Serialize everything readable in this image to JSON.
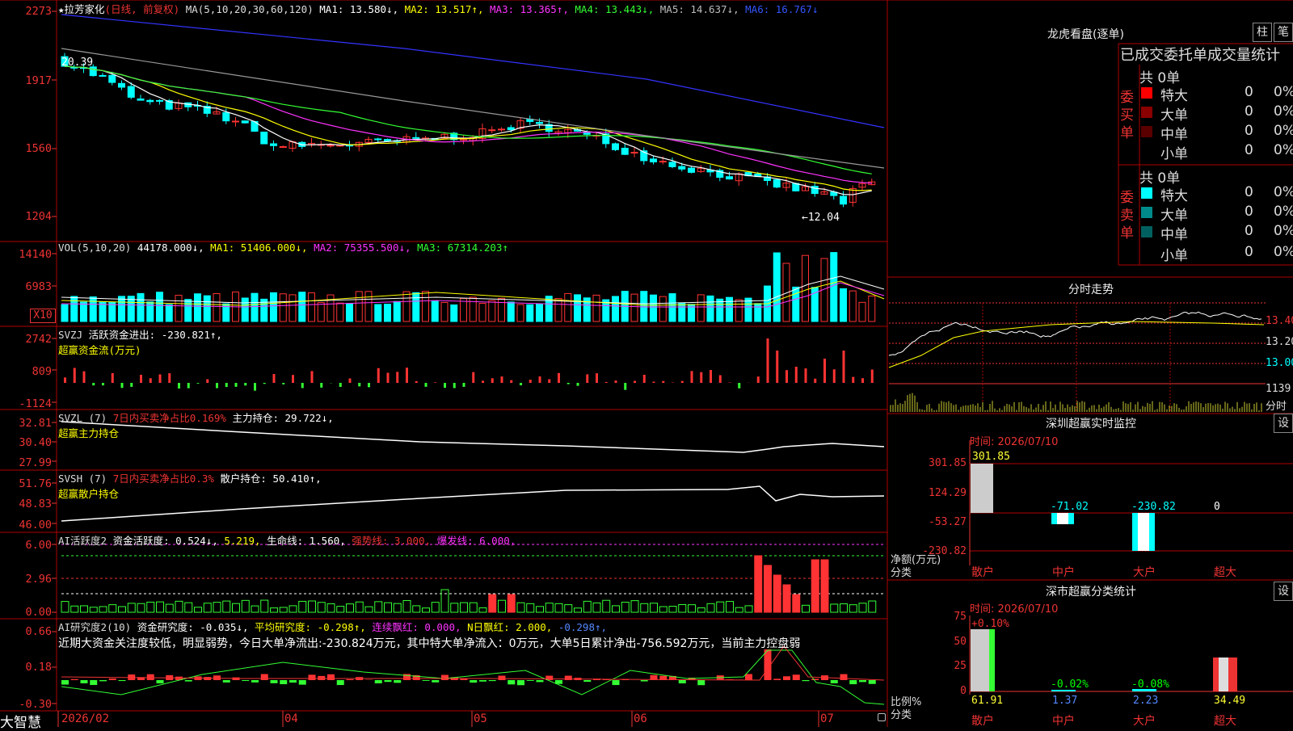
{
  "colors": {
    "up": "#ff3333",
    "down": "#00ffff",
    "ma1": "#ffffff",
    "ma2": "#ffff00",
    "ma3": "#ff33ff",
    "ma4": "#33ff33",
    "ma5": "#999999",
    "ma6": "#3333ff",
    "grid": "#aa0000"
  },
  "kline": {
    "header": {
      "star": "★",
      "name": "拉芳家化",
      "mode": "(日线, 前复权)",
      "ma_label": "MA(5,10,20,30,60,120)",
      "ma1": "MA1: 13.580↓,",
      "ma2": "MA2: 13.517↑,",
      "ma3": "MA3: 13.365↑,",
      "ma4": "MA4: 13.443↓,",
      "ma5": "MA5: 14.637↓,",
      "ma6": "MA6: 16.767↓"
    },
    "y_ticks": [
      "2273",
      "1917",
      "1560",
      "1204"
    ],
    "hi_label": "20.39",
    "lo_label": "←12.04"
  },
  "vol": {
    "header": {
      "label": "VOL(5,10,20)",
      "v": "44178.000↓,",
      "ma1": "MA1: 51406.000↓,",
      "ma2": "MA2: 75355.500↓,",
      "ma3": "MA3: 67314.203↑"
    },
    "y_ticks": [
      "14140",
      "6983"
    ],
    "unit": "X10"
  },
  "svzj": {
    "header": {
      "label": "SVZJ",
      "t": "活跃资金进出: -230.821↑,",
      "sub": "超赢资金流(万元)"
    },
    "y_ticks": [
      "2742",
      "809",
      "-1124"
    ]
  },
  "svzl": {
    "header": {
      "label": "SVZL (7)",
      "t1": "7日内买卖净占比0.169%",
      "t2": "主力持仓: 29.722↓,",
      "sub": "超赢主力持仓"
    },
    "y_ticks": [
      "32.81",
      "30.40",
      "27.99"
    ]
  },
  "svsh": {
    "header": {
      "label": "SVSH (7)",
      "t1": "7日内买卖净占比0.3%",
      "t2": "散户持仓: 50.410↑,",
      "sub": "超赢散户持仓"
    },
    "y_ticks": [
      "51.76",
      "48.83",
      "46.00"
    ]
  },
  "ai1": {
    "header": {
      "label": "AI活跃度2",
      "t1": "资金活跃度: 0.524↓,",
      "t2": "5.219,",
      "t3": "生命线: 1.560,",
      "t4": "强势线: 3.000,",
      "t5": "爆发线: 6.000,"
    },
    "y_ticks": [
      "6.00",
      "2.96",
      "0.00"
    ]
  },
  "ai2": {
    "header": {
      "label": "AI研究度2(10)",
      "t1": "资金研究度: -0.035↓,",
      "t2": "平均研究度: -0.298↑,",
      "t3": "连续飘红: 0.000,",
      "t4": "N日飘红: 2.000,",
      "t5": "-0.298↑,"
    },
    "comment": "近期大资金关注度较低，明显弱势，今日大单净流出:-230.824万元，其中特大单净流入：0万元，大单5日累计净出-756.592万元，当前主力控盘弱",
    "y_ticks": [
      "0.66",
      "0.18",
      "-0.30"
    ]
  },
  "xaxis": {
    "labels": [
      "2026/02",
      "04",
      "05",
      "06",
      "07"
    ]
  },
  "brand": "大智慧",
  "lhb": {
    "title": "龙虎看盘(逐单)",
    "btn1": "柱",
    "btn2": "笔",
    "subtitle": "已成交委托单成交量统计",
    "buy": {
      "side": "委买单",
      "total": "共 0单",
      "rows": [
        {
          "label": "特大",
          "count": "0",
          "pct": "0%"
        },
        {
          "label": "大单",
          "count": "0",
          "pct": "0%"
        },
        {
          "label": "中单",
          "count": "0",
          "pct": "0%"
        },
        {
          "label": "小单",
          "count": "0",
          "pct": "0%"
        }
      ]
    },
    "sell": {
      "side": "委卖单",
      "total": "共 0单",
      "rows": [
        {
          "label": "特大",
          "count": "0",
          "pct": "0%"
        },
        {
          "label": "大单",
          "count": "0",
          "pct": "0%"
        },
        {
          "label": "中单",
          "count": "0",
          "pct": "0%"
        },
        {
          "label": "小单",
          "count": "0",
          "pct": "0%"
        }
      ]
    }
  },
  "intraday": {
    "title": "分时走势",
    "y_ticks": [
      "13.40",
      "13.20",
      "13.00"
    ],
    "vol_tick": "1139",
    "vol_unit": "分时"
  },
  "szmonitor": {
    "title": "深圳超赢实时监控",
    "btn": "设",
    "time": "时间: 2026/07/10",
    "y_ticks": [
      "301.85",
      "124.29",
      "-53.27",
      "-230.82"
    ],
    "values": [
      {
        "label": "散户",
        "value": "301.85"
      },
      {
        "label": "中户",
        "value": "-71.02"
      },
      {
        "label": "大户",
        "value": "-230.82"
      },
      {
        "label": "超大",
        "value": "0"
      }
    ],
    "side_a": "净额(万元)",
    "side_b": "分类"
  },
  "szclass": {
    "title": "深市超赢分类统计",
    "btn": "设",
    "time": "时间: 2026/07/10",
    "y_ticks": [
      "75",
      "50",
      "25",
      "0"
    ],
    "top_labels": [
      "+0.10%",
      "-0.02%",
      "-0.08%",
      ""
    ],
    "values": [
      {
        "label": "散户",
        "value": "61.91"
      },
      {
        "label": "中户",
        "value": "1.37"
      },
      {
        "label": "大户",
        "value": "2.23"
      },
      {
        "label": "超大",
        "value": "34.49"
      }
    ],
    "side_a": "比例%",
    "side_b": "分类"
  }
}
